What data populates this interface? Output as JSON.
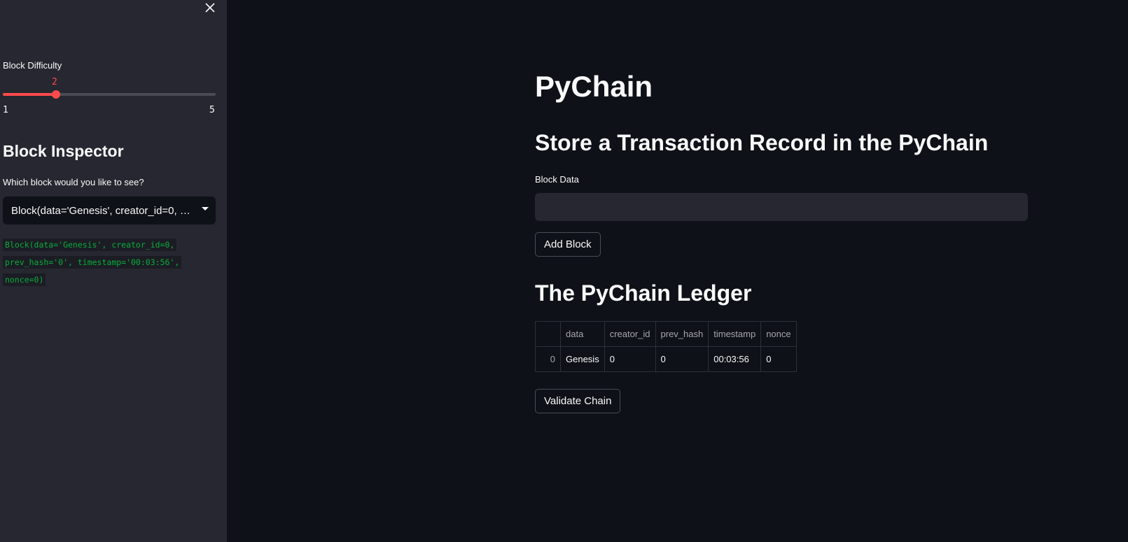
{
  "sidebar": {
    "close_icon": "close-icon",
    "slider": {
      "label": "Block Difficulty",
      "value": "2",
      "min": "1",
      "max": "5",
      "accent_color": "#ff4b4b"
    },
    "heading": "Block Inspector",
    "select": {
      "label": "Which block would you like to see?",
      "selected": "Block(data='Genesis', creator_id=0, prev_hash='0', timestamp='00:03:56', nonce=0)"
    },
    "code_output": "Block(data='Genesis', creator_id=0, prev_hash='0', timestamp='00:03:56', nonce=0)"
  },
  "main": {
    "title": "PyChain",
    "store_heading": "Store a Transaction Record in the PyChain",
    "block_data_label": "Block Data",
    "block_data_value": "",
    "add_block_label": "Add Block",
    "ledger_heading": "The PyChain Ledger",
    "ledger": {
      "columns": [
        "",
        "data",
        "creator_id",
        "prev_hash",
        "timestamp",
        "nonce"
      ],
      "rows": [
        {
          "index": "0",
          "data": "Genesis",
          "creator_id": "0",
          "prev_hash": "0",
          "timestamp": "00:03:56",
          "nonce": "0"
        }
      ]
    },
    "validate_label": "Validate Chain"
  },
  "colors": {
    "background": "#0e1117",
    "sidebar": "#262730",
    "code_text": "#09ab3b"
  }
}
